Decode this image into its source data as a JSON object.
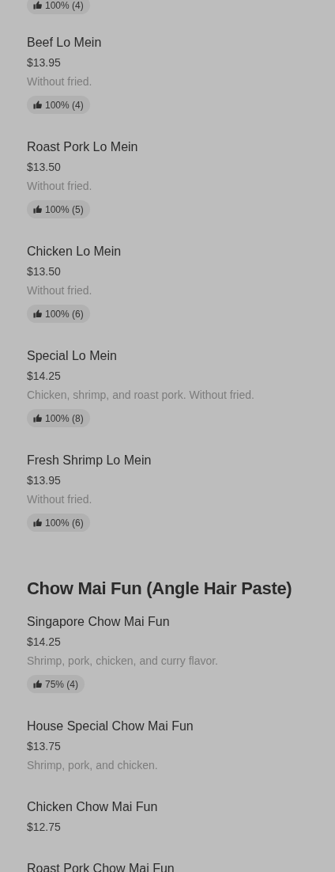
{
  "sections": [
    {
      "items": [
        {
          "rating": "100% (4)"
        },
        {
          "name": "Beef Lo Mein",
          "price": "$13.95",
          "description": "Without fried.",
          "rating": "100% (4)"
        },
        {
          "name": "Roast Pork Lo Mein",
          "price": "$13.50",
          "description": "Without fried.",
          "rating": "100% (5)"
        },
        {
          "name": "Chicken Lo Mein",
          "price": "$13.50",
          "description": "Without fried.",
          "rating": "100% (6)"
        },
        {
          "name": "Special Lo Mein",
          "price": "$14.25",
          "description": "Chicken, shrimp, and roast pork. Without fried.",
          "rating": "100% (8)"
        },
        {
          "name": "Fresh Shrimp Lo Mein",
          "price": "$13.95",
          "description": "Without fried.",
          "rating": "100% (6)"
        }
      ]
    },
    {
      "title": "Chow Mai Fun (Angle Hair Paste)",
      "items": [
        {
          "name": "Singapore Chow Mai Fun",
          "price": "$14.25",
          "description": "Shrimp, pork, chicken, and curry flavor.",
          "rating": "75% (4)"
        },
        {
          "name": "House Special Chow Mai Fun",
          "price": "$13.75",
          "description": "Shrimp, pork, and chicken."
        },
        {
          "name": "Chicken Chow Mai Fun",
          "price": "$12.75"
        },
        {
          "name": "Roast Pork Chow Mai Fun"
        }
      ]
    }
  ]
}
